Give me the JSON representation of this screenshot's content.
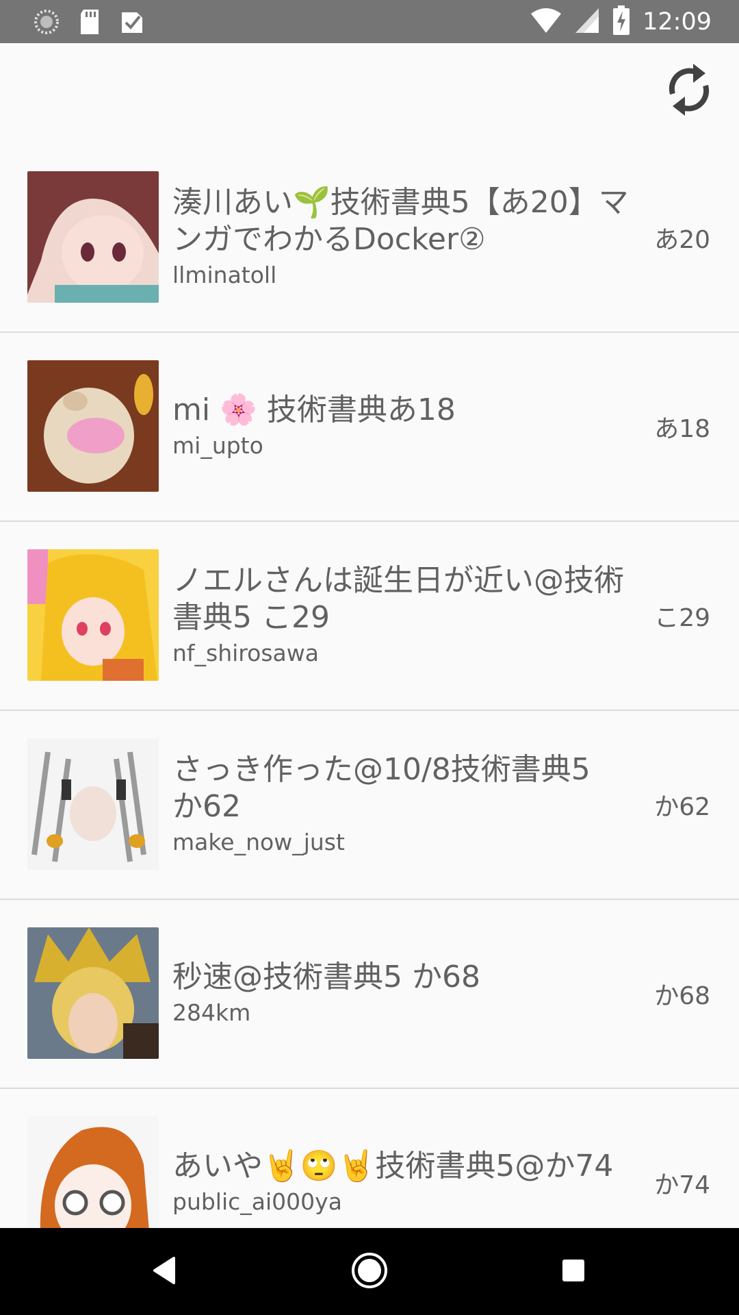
{
  "status_bar": {
    "time": "12:09",
    "left_icons": [
      "sync-spinner-icon",
      "sd-card-icon",
      "clipboard-check-icon"
    ],
    "right_icons": [
      "wifi-icon",
      "cell-signal-icon",
      "battery-charging-icon"
    ]
  },
  "toolbar": {
    "refresh_icon": "refresh-icon"
  },
  "circles": [
    {
      "title": "湊川あい🌱技術書典5【あ20】マンガでわかるDocker②",
      "user": "llminatoll",
      "space": "あ20",
      "avatar_color": "#8a4a4a"
    },
    {
      "title": "mi 🌸 技術書典あ18",
      "user": "mi_upto",
      "space": "あ18",
      "avatar_color": "#9a6a4a"
    },
    {
      "title": "ノエルさんは誕生日が近い@技術書典5 こ29",
      "user": "nf_shirosawa",
      "space": "こ29",
      "avatar_color": "#e8c040"
    },
    {
      "title": "さっき作った@10/8技術書典5 か62",
      "user": "make_now_just",
      "space": "か62",
      "avatar_color": "#cfcfcf"
    },
    {
      "title": "秒速@技術書典5 か68",
      "user": "284km",
      "space": "か68",
      "avatar_color": "#c0a040"
    },
    {
      "title": "あいや🤘🙄🤘技術書典5@か74",
      "user": "public_ai000ya",
      "space": "か74",
      "avatar_color": "#d46a20"
    }
  ],
  "nav_bar": {
    "back_icon": "back-triangle-icon",
    "home_icon": "home-circle-icon",
    "recents_icon": "recents-square-icon"
  }
}
